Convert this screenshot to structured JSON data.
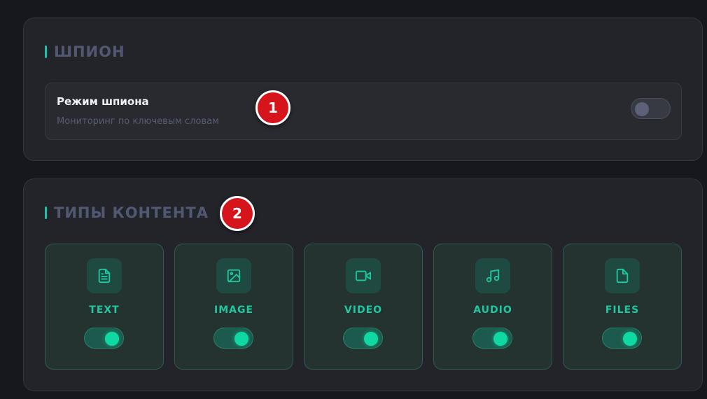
{
  "spy_section": {
    "title": "ШПИОН",
    "setting": {
      "label": "Режим шпиона",
      "description": "Мониторинг по ключевым словам",
      "enabled": false
    }
  },
  "content_section": {
    "title": "ТИПЫ КОНТЕНТА",
    "types": [
      {
        "label": "TEXT",
        "icon": "file-text-icon",
        "enabled": true
      },
      {
        "label": "IMAGE",
        "icon": "image-icon",
        "enabled": true
      },
      {
        "label": "VIDEO",
        "icon": "video-icon",
        "enabled": true
      },
      {
        "label": "AUDIO",
        "icon": "music-icon",
        "enabled": true
      },
      {
        "label": "FILES",
        "icon": "file-icon",
        "enabled": true
      }
    ]
  },
  "annotations": {
    "badge_1": "1",
    "badge_2": "2"
  },
  "colors": {
    "accent": "#18c2ad",
    "toggle_on": "#10d8a2",
    "badge": "#d6141c"
  }
}
